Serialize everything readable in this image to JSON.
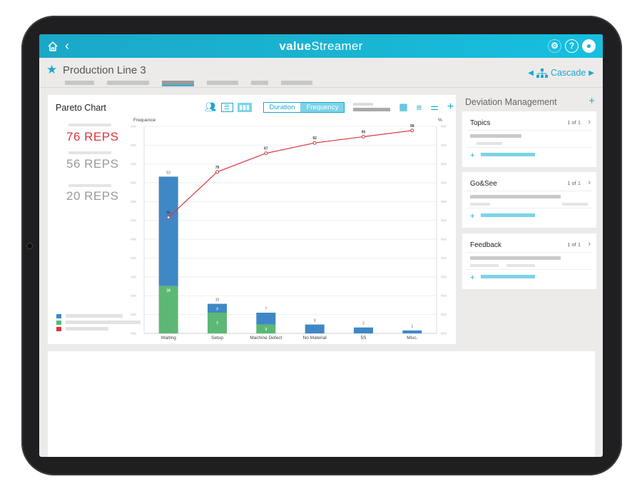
{
  "header": {
    "logo_part1": "value",
    "logo_part2": "Streamer",
    "icons": [
      "home-icon",
      "back-icon",
      "settings-icon",
      "help-icon",
      "user-icon"
    ]
  },
  "page": {
    "title": "Production Line 3",
    "cascade_label": "Cascade"
  },
  "pareto": {
    "title": "Pareto Chart",
    "toggle": [
      "Duration",
      "Frequency"
    ],
    "toggle_selected": "Frequency",
    "stats": [
      {
        "value": "76 REPS",
        "color": "#d9363e"
      },
      {
        "value": "56 REPS",
        "color": "#9a9a9a"
      },
      {
        "value": "20 REPS",
        "color": "#9a9a9a"
      }
    ],
    "legend_colors": [
      "#3f88c5",
      "#5cb874",
      "#d9363e"
    ]
  },
  "chart_data": {
    "type": "bar",
    "ylabel": "Frequence",
    "y2label": "%",
    "categories": [
      "Waiting",
      "Setup",
      "Machine Defect",
      "No Material",
      "5S",
      "Misc."
    ],
    "series": [
      {
        "color": "#5cb874",
        "values": [
          16,
          7,
          3,
          0,
          0,
          0
        ]
      },
      {
        "color": "#3f88c5",
        "values": [
          37,
          3,
          4,
          3,
          2,
          1
        ]
      }
    ],
    "totals": [
      53,
      10,
      7,
      3,
      2,
      1
    ],
    "cumulative_percent": {
      "color": "#d9363e",
      "values": [
        56,
        78,
        87,
        92,
        95,
        98
      ]
    },
    "ylim": [
      0,
      70
    ],
    "y2lim": [
      0,
      100
    ]
  },
  "deviation": {
    "title": "Deviation Management",
    "cards": [
      {
        "title": "Topics",
        "count": "1 of 1"
      },
      {
        "title": "Go&See",
        "count": "1 of 1"
      },
      {
        "title": "Feedback",
        "count": "1 of 1"
      }
    ]
  }
}
